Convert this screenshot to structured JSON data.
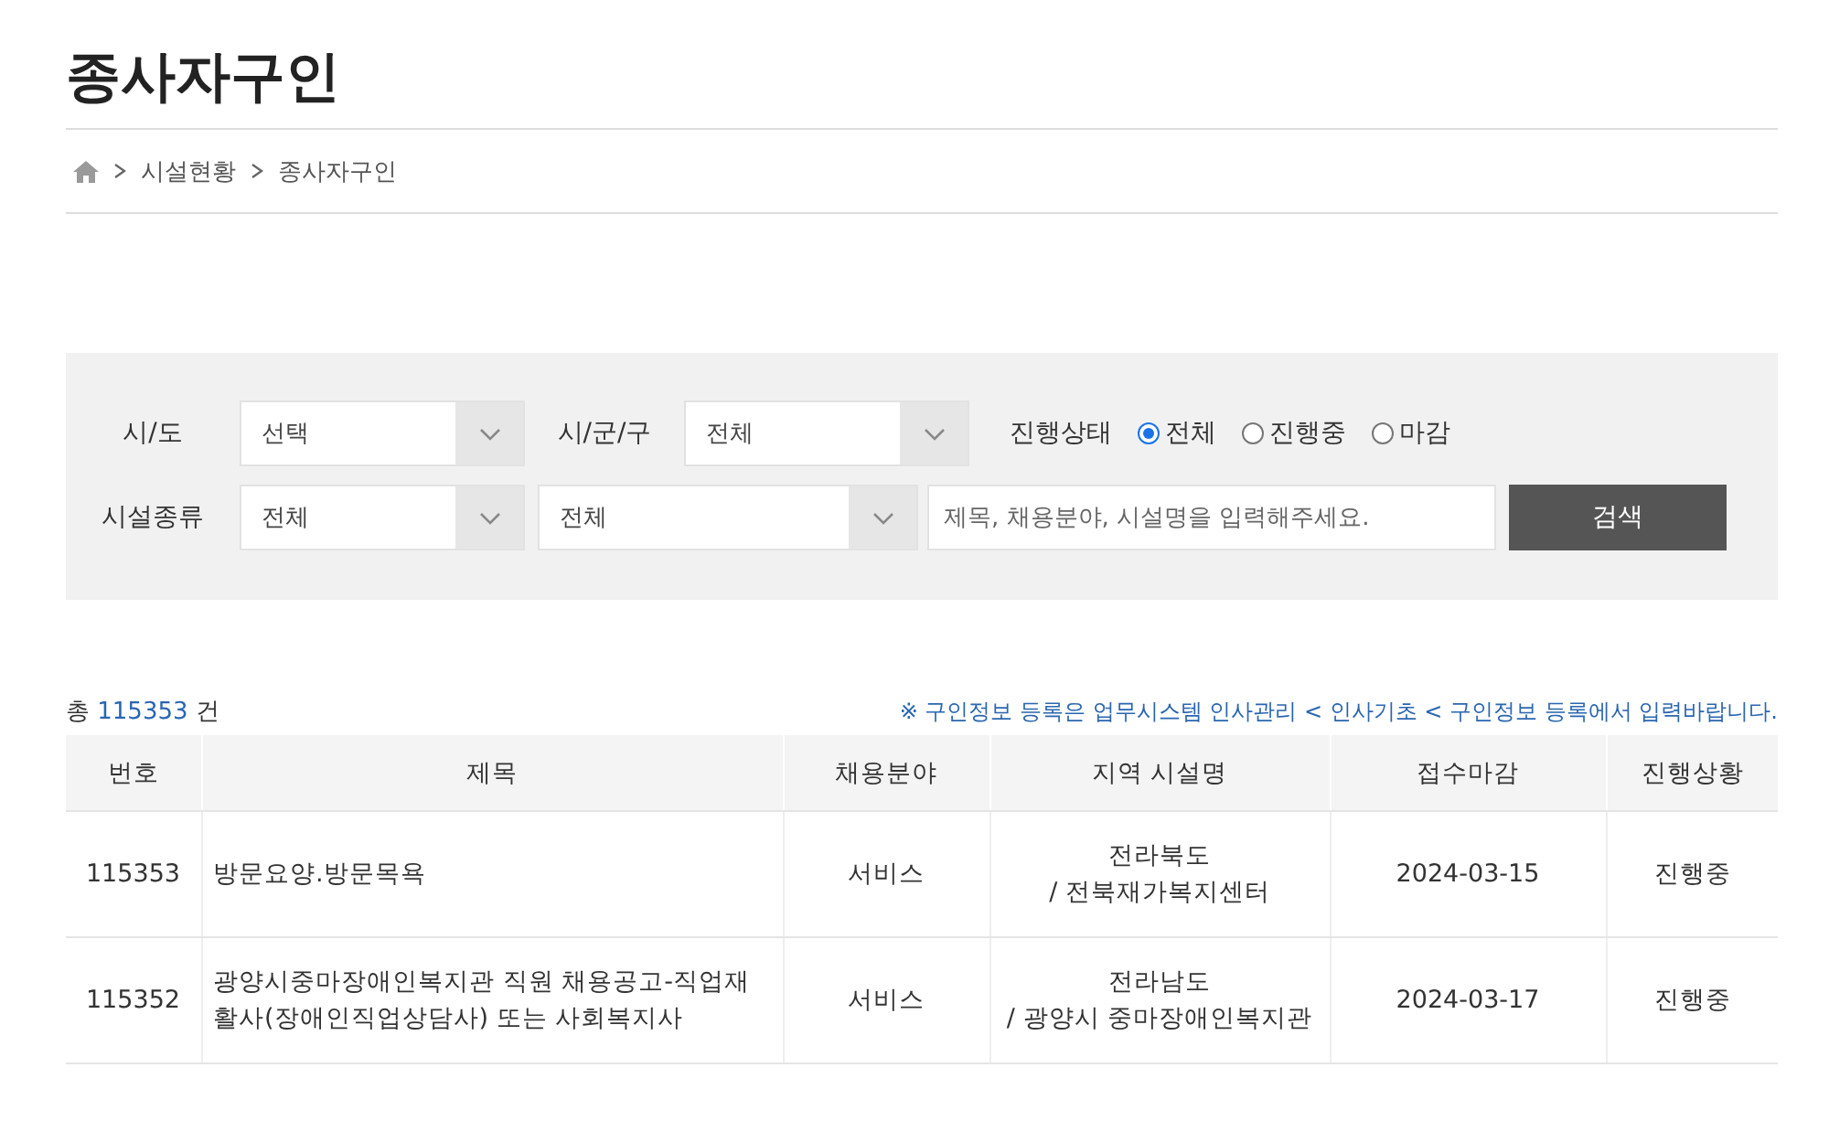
{
  "page_title": "종사자구인",
  "breadcrumb": [
    "시설현황",
    "종사자구인"
  ],
  "filters": {
    "region_label": "시/도",
    "region_value": "선택",
    "city_label": "시/군/구",
    "city_value": "전체",
    "status_label": "진행상태",
    "status_options": [
      {
        "label": "전체",
        "selected": true
      },
      {
        "label": "진행중",
        "selected": false
      },
      {
        "label": "마감",
        "selected": false
      }
    ],
    "type_label": "시설종류",
    "type_value": "전체",
    "subtype_value": "전체",
    "search_placeholder": "제목, 채용분야, 시설명을 입력해주세요.",
    "search_button": "검색"
  },
  "total": {
    "prefix": "총",
    "count": "115353",
    "suffix": "건"
  },
  "notice": "※ 구인정보 등록은 업무시스템 인사관리 < 인사기초 < 구인정보 등록에서 입력바랍니다.",
  "table": {
    "columns": [
      "번호",
      "제목",
      "채용분야",
      "지역 시설명",
      "접수마감",
      "진행상황"
    ],
    "rows": [
      {
        "number": "115353",
        "title": "방문요양.방문목욕",
        "field": "서비스",
        "region": "전라북도",
        "facility": "/ 전북재가복지센터",
        "deadline": "2024-03-15",
        "status": "진행중"
      },
      {
        "number": "115352",
        "title": "광양시중마장애인복지관 직원 채용공고-직업재활사(장애인직업상담사) 또는 사회복지사",
        "field": "서비스",
        "region": "전라남도",
        "facility": "/ 광양시 중마장애인복지관",
        "deadline": "2024-03-17",
        "status": "진행중"
      }
    ]
  }
}
